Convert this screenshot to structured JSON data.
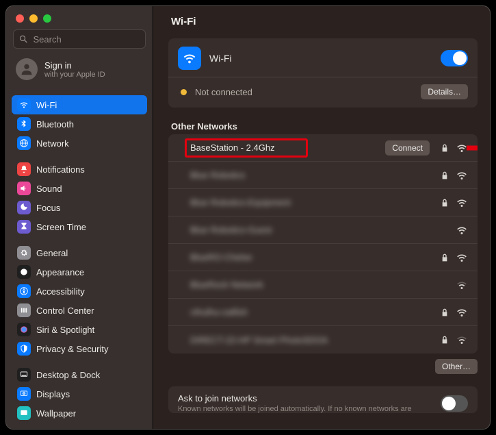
{
  "window_title": "Wi-Fi",
  "search": {
    "placeholder": "Search"
  },
  "signin": {
    "title": "Sign in",
    "subtitle": "with your Apple ID"
  },
  "sidebar": {
    "groups": [
      {
        "items": [
          {
            "label": "Wi-Fi",
            "icon": "wifi",
            "color": "#0a7aff",
            "selected": true
          },
          {
            "label": "Bluetooth",
            "icon": "bluetooth",
            "color": "#0a7aff"
          },
          {
            "label": "Network",
            "icon": "network",
            "color": "#0a7aff"
          }
        ]
      },
      {
        "items": [
          {
            "label": "Notifications",
            "icon": "bell",
            "color": "#ef4444"
          },
          {
            "label": "Sound",
            "icon": "sound",
            "color": "#ec4899"
          },
          {
            "label": "Focus",
            "icon": "focus",
            "color": "#6d5bd0"
          },
          {
            "label": "Screen Time",
            "icon": "hourglass",
            "color": "#6d5bd0"
          }
        ]
      },
      {
        "items": [
          {
            "label": "General",
            "icon": "gear",
            "color": "#8e8e93"
          },
          {
            "label": "Appearance",
            "icon": "appearance",
            "color": "#1f1f1f"
          },
          {
            "label": "Accessibility",
            "icon": "accessibility",
            "color": "#0a7aff"
          },
          {
            "label": "Control Center",
            "icon": "control",
            "color": "#8e8e93"
          },
          {
            "label": "Siri & Spotlight",
            "icon": "siri",
            "color": "#1f1f1f"
          },
          {
            "label": "Privacy & Security",
            "icon": "privacy",
            "color": "#0a7aff"
          }
        ]
      },
      {
        "items": [
          {
            "label": "Desktop & Dock",
            "icon": "dock",
            "color": "#1f1f1f"
          },
          {
            "label": "Displays",
            "icon": "displays",
            "color": "#0a7aff"
          },
          {
            "label": "Wallpaper",
            "icon": "wallpaper",
            "color": "#22c0c0"
          }
        ]
      }
    ]
  },
  "wifi_card": {
    "title": "Wi-Fi",
    "status": "Not connected",
    "details_button": "Details…",
    "enabled": true
  },
  "other_networks_label": "Other Networks",
  "networks": [
    {
      "name": "BaseStation - 2.4Ghz",
      "locked": true,
      "signal": 3,
      "highlighted": true,
      "connect_label": "Connect",
      "blur": false
    },
    {
      "name": "Blue Robotics",
      "locked": true,
      "signal": 3,
      "blur": true
    },
    {
      "name": "Blue Robotics-Equipment",
      "locked": true,
      "signal": 3,
      "blur": true
    },
    {
      "name": "Blue Robotics-Guest",
      "locked": false,
      "signal": 3,
      "blur": true
    },
    {
      "name": "BlueRO-Chelse",
      "locked": true,
      "signal": 3,
      "blur": true
    },
    {
      "name": "BlueRock Network",
      "locked": false,
      "signal": 2,
      "blur": true
    },
    {
      "name": "cthulhu-catfish",
      "locked": true,
      "signal": 3,
      "blur": true
    },
    {
      "name": "DIRECT-22-HP Smart PhotoSDOA",
      "locked": true,
      "signal": 2,
      "blur": true
    }
  ],
  "other_button": "Other…",
  "ask": {
    "title": "Ask to join networks",
    "subtitle": "Known networks will be joined automatically. If no known networks are",
    "enabled": false
  },
  "annotation": {
    "highlight_target": "BaseStation - 2.4Ghz",
    "arrow_color": "#e3000f"
  }
}
